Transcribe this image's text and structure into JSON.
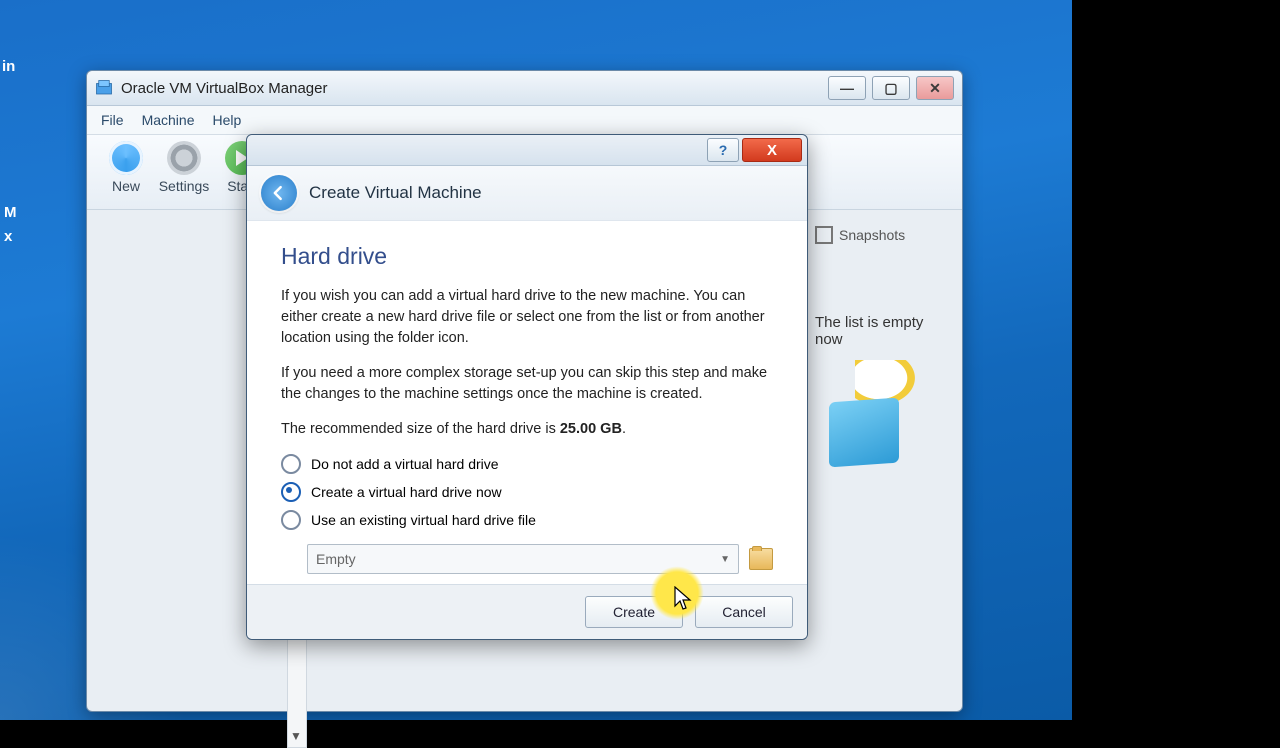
{
  "window": {
    "title": "Oracle VM VirtualBox Manager",
    "menu": {
      "file": "File",
      "machine": "Machine",
      "help": "Help"
    },
    "toolbar": {
      "new": "New",
      "settings": "Settings",
      "start": "Start"
    },
    "right": {
      "snapshots": "Snapshots",
      "empty_hint": "The list is empty now"
    }
  },
  "sidebar_fragment": {
    "in": "in",
    "m": "M",
    "x": "x"
  },
  "wizard": {
    "title": "Create Virtual Machine",
    "section": "Hard drive",
    "p1": "If you wish you can add a virtual hard drive to the new machine. You can either create a new hard drive file or select one from the list or from another location using the folder icon.",
    "p2": "If you need a more complex storage set-up you can skip this step and make the changes to the machine settings once the machine is created.",
    "rec_pre": "The recommended size of the hard drive is ",
    "rec_val": "25.00 GB",
    "rec_post": ".",
    "opt1": "Do not add a virtual hard drive",
    "opt2": "Create a virtual hard drive now",
    "opt3": "Use an existing virtual hard drive file",
    "selected_option": 2,
    "combo_value": "Empty",
    "create": "Create",
    "cancel": "Cancel",
    "help_tip": "?",
    "close_tip": "X"
  }
}
